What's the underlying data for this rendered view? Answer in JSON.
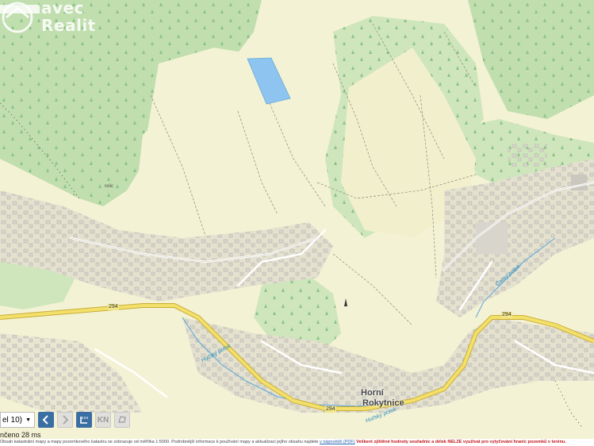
{
  "logo": {
    "line1": "avec",
    "line2": "Realit"
  },
  "places": {
    "town": [
      "Horní",
      "Rokytnice"
    ]
  },
  "roads": {
    "number": "294"
  },
  "streams": {
    "hutsky": "Huťský potok",
    "hutsky2": "Huťský potok",
    "cerny": "Černý potok"
  },
  "minor_labels": {
    "relic": "relic"
  },
  "toolbar": {
    "zoom_value": "el 10)",
    "kn_label": "KN"
  },
  "status": {
    "load_time": "nčeno 28 ms"
  },
  "footer": {
    "info": "Obsah katastrální mapy a mapy pozemkového katastru se zobrazuje od měřítka 1:5000. Podrobnější informace k používání mapy a aktualizaci jejího obsahu najdete",
    "link": "v nápovědě (PDF)",
    "warning": "Veškeré zjištěné hodnoty souřadnic a délek NELZE využívat pro vytyčování hranic pozemků v terénu."
  },
  "colors": {
    "forest": "#b9d9a8",
    "meadow": "#f4f2d4",
    "water": "#8ec5f0",
    "road": "#f2e06a",
    "road_edge": "#c9ad3a",
    "toolbar_active": "#3b6fa3"
  }
}
